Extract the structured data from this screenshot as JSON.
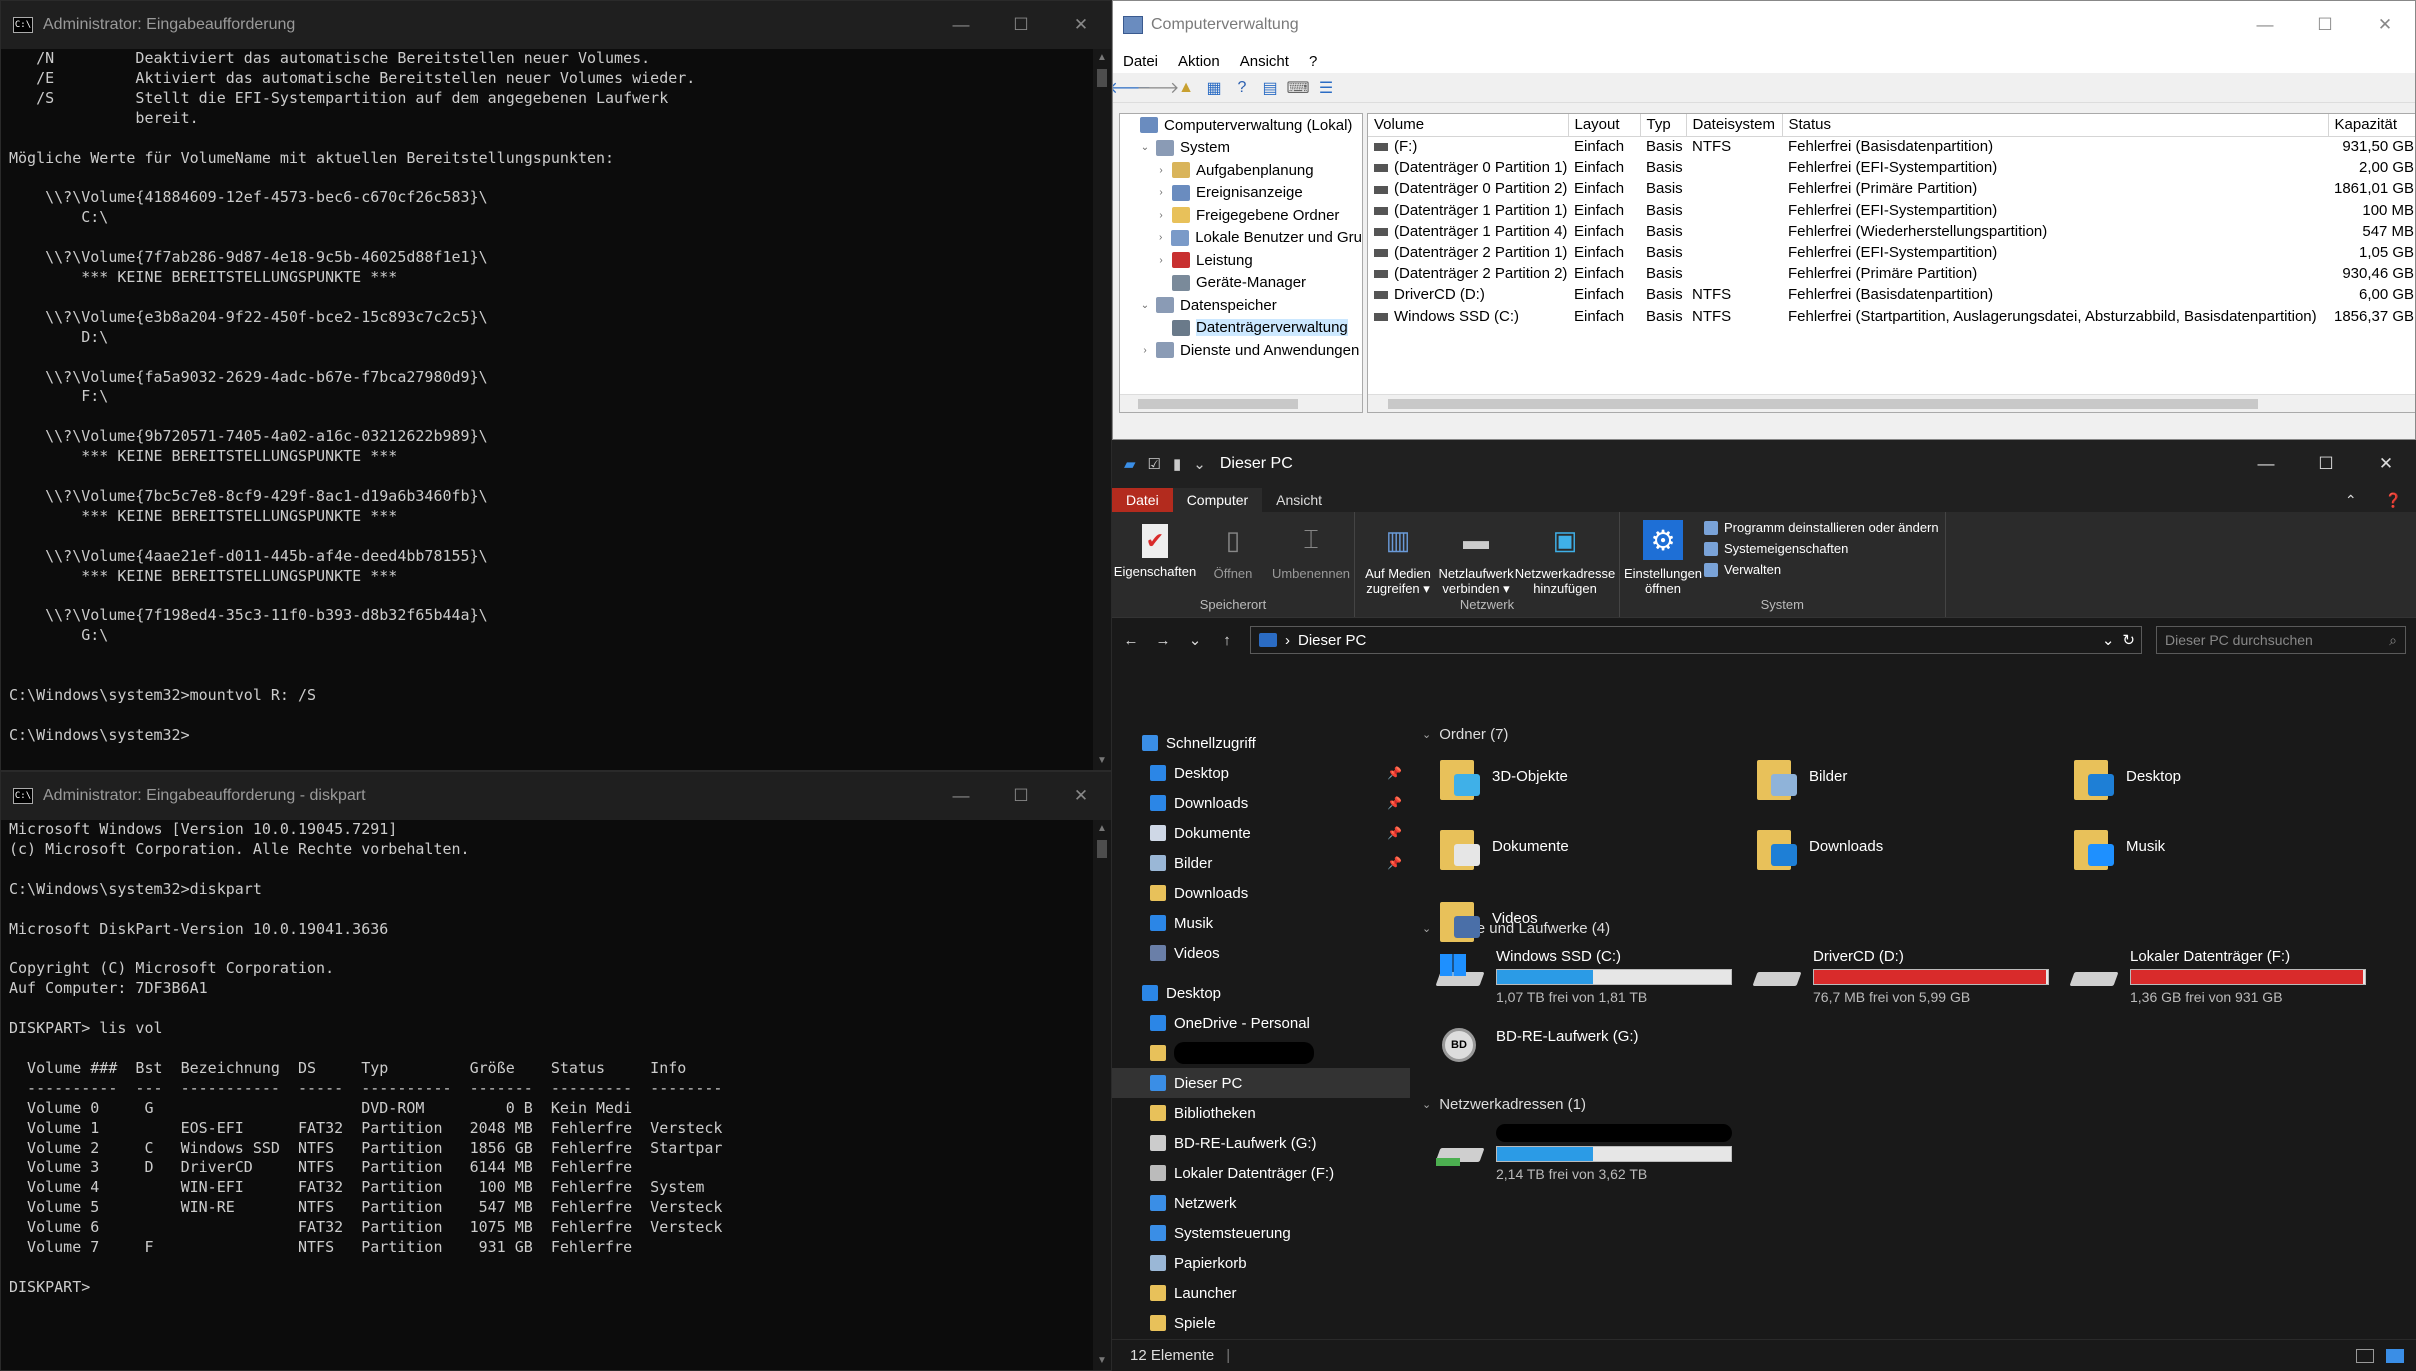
{
  "cmd1": {
    "title": "Administrator: Eingabeaufforderung",
    "lines": [
      "   /N         Deaktiviert das automatische Bereitstellen neuer Volumes.",
      "   /E         Aktiviert das automatische Bereitstellen neuer Volumes wieder.",
      "   /S         Stellt die EFI-Systempartition auf dem angegebenen Laufwerk",
      "              bereit.",
      "",
      "Mögliche Werte für VolumeName mit aktuellen Bereitstellungspunkten:",
      "",
      "    \\\\?\\Volume{41884609-12ef-4573-bec6-c670cf26c583}\\",
      "        C:\\",
      "",
      "    \\\\?\\Volume{7f7ab286-9d87-4e18-9c5b-46025d88f1e1}\\",
      "        *** KEINE BEREITSTELLUNGSPUNKTE ***",
      "",
      "    \\\\?\\Volume{e3b8a204-9f22-450f-bce2-15c893c7c2c5}\\",
      "        D:\\",
      "",
      "    \\\\?\\Volume{fa5a9032-2629-4adc-b67e-f7bca27980d9}\\",
      "        F:\\",
      "",
      "    \\\\?\\Volume{9b720571-7405-4a02-a16c-03212622b989}\\",
      "        *** KEINE BEREITSTELLUNGSPUNKTE ***",
      "",
      "    \\\\?\\Volume{7bc5c7e8-8cf9-429f-8ac1-d19a6b3460fb}\\",
      "        *** KEINE BEREITSTELLUNGSPUNKTE ***",
      "",
      "    \\\\?\\Volume{4aae21ef-d011-445b-af4e-deed4bb78155}\\",
      "        *** KEINE BEREITSTELLUNGSPUNKTE ***",
      "",
      "    \\\\?\\Volume{7f198ed4-35c3-11f0-b393-d8b32f65b44a}\\",
      "        G:\\",
      "",
      "",
      "C:\\Windows\\system32>mountvol R: /S",
      "",
      "C:\\Windows\\system32>"
    ]
  },
  "cmd2": {
    "title": "Administrator: Eingabeaufforderung - diskpart",
    "lines": [
      "Microsoft Windows [Version 10.0.19045.7291]",
      "(c) Microsoft Corporation. Alle Rechte vorbehalten.",
      "",
      "C:\\Windows\\system32>diskpart",
      "",
      "Microsoft DiskPart-Version 10.0.19041.3636",
      "",
      "Copyright (C) Microsoft Corporation.",
      "Auf Computer: 7DF3B6A1",
      "",
      "DISKPART> lis vol",
      "",
      "  Volume ###  Bst  Bezeichnung  DS     Typ         Größe    Status     Info",
      "  ----------  ---  -----------  -----  ----------  -------  ---------  --------",
      "  Volume 0     G                       DVD-ROM         0 B  Kein Medi",
      "  Volume 1         EOS-EFI      FAT32  Partition   2048 MB  Fehlerfre  Versteck",
      "  Volume 2     C   Windows SSD  NTFS   Partition   1856 GB  Fehlerfre  Startpar",
      "  Volume 3     D   DriverCD     NTFS   Partition   6144 MB  Fehlerfre",
      "  Volume 4         WIN-EFI      FAT32  Partition    100 MB  Fehlerfre  System",
      "  Volume 5         WIN-RE       NTFS   Partition    547 MB  Fehlerfre  Versteck",
      "  Volume 6                      FAT32  Partition   1075 MB  Fehlerfre  Versteck",
      "  Volume 7     F                NTFS   Partition    931 GB  Fehlerfre",
      "",
      "DISKPART>"
    ]
  },
  "cv": {
    "title": "Computerverwaltung",
    "menu": [
      "Datei",
      "Aktion",
      "Ansicht",
      "?"
    ],
    "tree": [
      {
        "label": "Computerverwaltung (Lokal)",
        "indent": 0,
        "ex": "",
        "color": "#6a8cbf"
      },
      {
        "label": "System",
        "indent": 1,
        "ex": "⌄",
        "color": "#8a9bb5"
      },
      {
        "label": "Aufgabenplanung",
        "indent": 2,
        "ex": "›",
        "color": "#d9b45a"
      },
      {
        "label": "Ereignisanzeige",
        "indent": 2,
        "ex": "›",
        "color": "#6a8cbf"
      },
      {
        "label": "Freigegebene Ordner",
        "indent": 2,
        "ex": "›",
        "color": "#e8c15a"
      },
      {
        "label": "Lokale Benutzer und Gru",
        "indent": 2,
        "ex": "›",
        "color": "#7a9ac8"
      },
      {
        "label": "Leistung",
        "indent": 2,
        "ex": "›",
        "color": "#c83030"
      },
      {
        "label": "Geräte-Manager",
        "indent": 2,
        "ex": "",
        "color": "#7a8a9a"
      },
      {
        "label": "Datenspeicher",
        "indent": 1,
        "ex": "⌄",
        "color": "#8a9bb5"
      },
      {
        "label": "Datenträgerverwaltung",
        "indent": 2,
        "ex": "",
        "color": "#6a7a8a",
        "selected": true
      },
      {
        "label": "Dienste und Anwendungen",
        "indent": 1,
        "ex": "›",
        "color": "#8a9bb5"
      }
    ],
    "columns": [
      "Volume",
      "Layout",
      "Typ",
      "Dateisystem",
      "Status",
      "Kapazität"
    ],
    "rows": [
      [
        "(F:)",
        "Einfach",
        "Basis",
        "NTFS",
        "Fehlerfrei (Basisdatenpartition)",
        "931,50 GB"
      ],
      [
        "(Datenträger 0 Partition 1)",
        "Einfach",
        "Basis",
        "",
        "Fehlerfrei (EFI-Systempartition)",
        "2,00 GB"
      ],
      [
        "(Datenträger 0 Partition 2)",
        "Einfach",
        "Basis",
        "",
        "Fehlerfrei (Primäre Partition)",
        "1861,01 GB"
      ],
      [
        "(Datenträger 1 Partition 1)",
        "Einfach",
        "Basis",
        "",
        "Fehlerfrei (EFI-Systempartition)",
        "100 MB"
      ],
      [
        "(Datenträger 1 Partition 4)",
        "Einfach",
        "Basis",
        "",
        "Fehlerfrei (Wiederherstellungspartition)",
        "547 MB"
      ],
      [
        "(Datenträger 2 Partition 1)",
        "Einfach",
        "Basis",
        "",
        "Fehlerfrei (EFI-Systempartition)",
        "1,05 GB"
      ],
      [
        "(Datenträger 2 Partition 2)",
        "Einfach",
        "Basis",
        "",
        "Fehlerfrei (Primäre Partition)",
        "930,46 GB"
      ],
      [
        "DriverCD (D:)",
        "Einfach",
        "Basis",
        "NTFS",
        "Fehlerfrei (Basisdatenpartition)",
        "6,00 GB"
      ],
      [
        "Windows SSD (C:)",
        "Einfach",
        "Basis",
        "NTFS",
        "Fehlerfrei (Startpartition, Auslagerungsdatei, Absturzabbild, Basisdatenpartition)",
        "1856,37 GB"
      ]
    ]
  },
  "ex": {
    "title": "Dieser PC",
    "tabs": [
      "Datei",
      "Computer",
      "Ansicht"
    ],
    "ribbon": {
      "speicherort": {
        "label": "Speicherort",
        "buttons": [
          "Eigenschaften",
          "Öffnen",
          "Umbenennen"
        ]
      },
      "netzwerk": {
        "label": "Netzwerk",
        "buttons": [
          "Auf Medien zugreifen ▾",
          "Netzlaufwerk verbinden ▾",
          "Netzwerkadresse hinzufügen"
        ]
      },
      "system": {
        "label": "System",
        "button": "Einstellungen öffnen",
        "small": [
          "Programm deinstallieren oder ändern",
          "Systemeigenschaften",
          "Verwalten"
        ]
      }
    },
    "path": "Dieser PC",
    "search_placeholder": "Dieser PC durchsuchen",
    "nav": [
      {
        "label": "Schnellzugriff",
        "indent": 0,
        "color": "#3a8ee6"
      },
      {
        "label": "Desktop",
        "indent": 1,
        "color": "#2b86e6",
        "pin": true
      },
      {
        "label": "Downloads",
        "indent": 1,
        "color": "#2b86e6",
        "pin": true
      },
      {
        "label": "Dokumente",
        "indent": 1,
        "color": "#cfd8e6",
        "pin": true
      },
      {
        "label": "Bilder",
        "indent": 1,
        "color": "#9ab7d6",
        "pin": true
      },
      {
        "label": "Downloads",
        "indent": 1,
        "color": "#e8c15a"
      },
      {
        "label": "Musik",
        "indent": 1,
        "color": "#2b86e6"
      },
      {
        "label": "Videos",
        "indent": 1,
        "color": "#6a7fa8"
      },
      {
        "label": "",
        "indent": 0,
        "color": "",
        "spacer": true
      },
      {
        "label": "Desktop",
        "indent": 0,
        "color": "#2b86e6"
      },
      {
        "label": "OneDrive - Personal",
        "indent": 1,
        "color": "#2b86e6"
      },
      {
        "label": "",
        "indent": 1,
        "color": "#e8c15a",
        "redacted": true
      },
      {
        "label": "Dieser PC",
        "indent": 1,
        "color": "#3a8ee6",
        "selected": true
      },
      {
        "label": "Bibliotheken",
        "indent": 1,
        "color": "#e8c15a"
      },
      {
        "label": "BD-RE-Laufwerk (G:)",
        "indent": 1,
        "color": "#cccccc"
      },
      {
        "label": "Lokaler Datenträger (F:)",
        "indent": 1,
        "color": "#bbbbbb"
      },
      {
        "label": "Netzwerk",
        "indent": 1,
        "color": "#3a8ee6"
      },
      {
        "label": "Systemsteuerung",
        "indent": 1,
        "color": "#3a8ee6"
      },
      {
        "label": "Papierkorb",
        "indent": 1,
        "color": "#9ab7d6"
      },
      {
        "label": "Launcher",
        "indent": 1,
        "color": "#e8c15a"
      },
      {
        "label": "Spiele",
        "indent": 1,
        "color": "#e8c15a"
      }
    ],
    "sections": {
      "ordner": "Ordner (7)",
      "geraete": "Geräte und Laufwerke (4)",
      "netz": "Netzwerkadressen (1)"
    },
    "folders": [
      {
        "label": "3D-Objekte",
        "overlay": "#3fb0e8"
      },
      {
        "label": "Bilder",
        "overlay": "#8fb3d9"
      },
      {
        "label": "Desktop",
        "overlay": "#1e7fd6"
      },
      {
        "label": "Dokumente",
        "overlay": "#e6e6e6"
      },
      {
        "label": "Downloads",
        "overlay": "#1e7fd6"
      },
      {
        "label": "Musik",
        "overlay": "#1e90ff"
      },
      {
        "label": "Videos",
        "overlay": "#4a6fa8"
      }
    ],
    "drives": [
      {
        "label": "Windows SSD (C:)",
        "free": "1,07 TB frei von 1,81 TB",
        "used_fraction": 0.41,
        "color": "#2b9be6",
        "icon": "win"
      },
      {
        "label": "DriverCD (D:)",
        "free": "76,7 MB frei von 5,99 GB",
        "used_fraction": 0.99,
        "color": "#d92b2b",
        "icon": "hd"
      },
      {
        "label": "Lokaler Datenträger (F:)",
        "free": "1,36 GB frei von 931 GB",
        "used_fraction": 0.99,
        "color": "#d92b2b",
        "icon": "hd"
      },
      {
        "label": "BD-RE-Laufwerk (G:)",
        "free": "",
        "used_fraction": null,
        "color": "",
        "icon": "disc"
      }
    ],
    "network": {
      "free": "2,14 TB frei von 3,62 TB",
      "used_fraction": 0.41,
      "color": "#2b9be6"
    },
    "status": "12 Elemente"
  }
}
